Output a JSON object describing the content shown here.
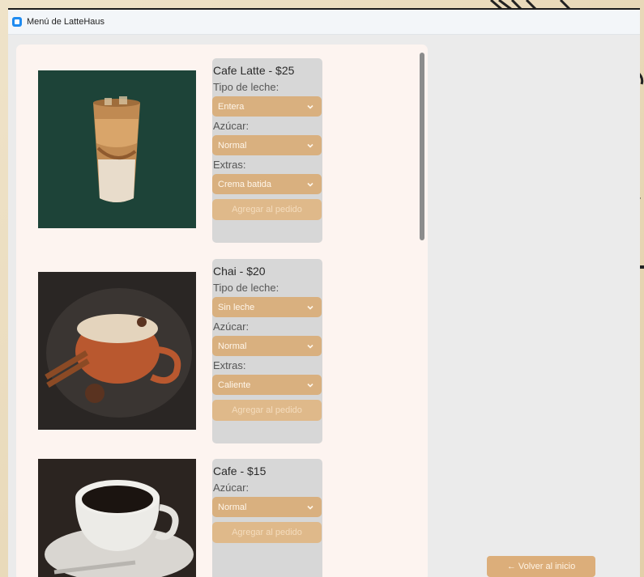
{
  "window": {
    "title": "Menú de LatteHaus"
  },
  "items": [
    {
      "title": "Cafe Latte - $25",
      "fields": [
        {
          "label": "Tipo de leche:",
          "value": "Entera"
        },
        {
          "label": "Azúcar:",
          "value": "Normal"
        },
        {
          "label": "Extras:",
          "value": "Crema batida"
        }
      ],
      "add_label": "Agregar al pedido"
    },
    {
      "title": "Chai - $20",
      "fields": [
        {
          "label": "Tipo de leche:",
          "value": "Sin leche"
        },
        {
          "label": "Azúcar:",
          "value": "Normal"
        },
        {
          "label": "Extras:",
          "value": "Caliente"
        }
      ],
      "add_label": "Agregar al pedido"
    },
    {
      "title": "Cafe - $15",
      "fields": [
        {
          "label": "Azúcar:",
          "value": "Normal"
        }
      ],
      "add_label": "Agregar al pedido"
    }
  ],
  "back_button": {
    "label": "← Volver al inicio"
  },
  "colors": {
    "accent": "#d9b07f",
    "panel": "#fdf4f0",
    "card": "#d7d7d7"
  },
  "icons": {
    "app": "app-icon",
    "dropdown": "chevron-down-icon",
    "scroll": "scrollbar-thumb"
  }
}
